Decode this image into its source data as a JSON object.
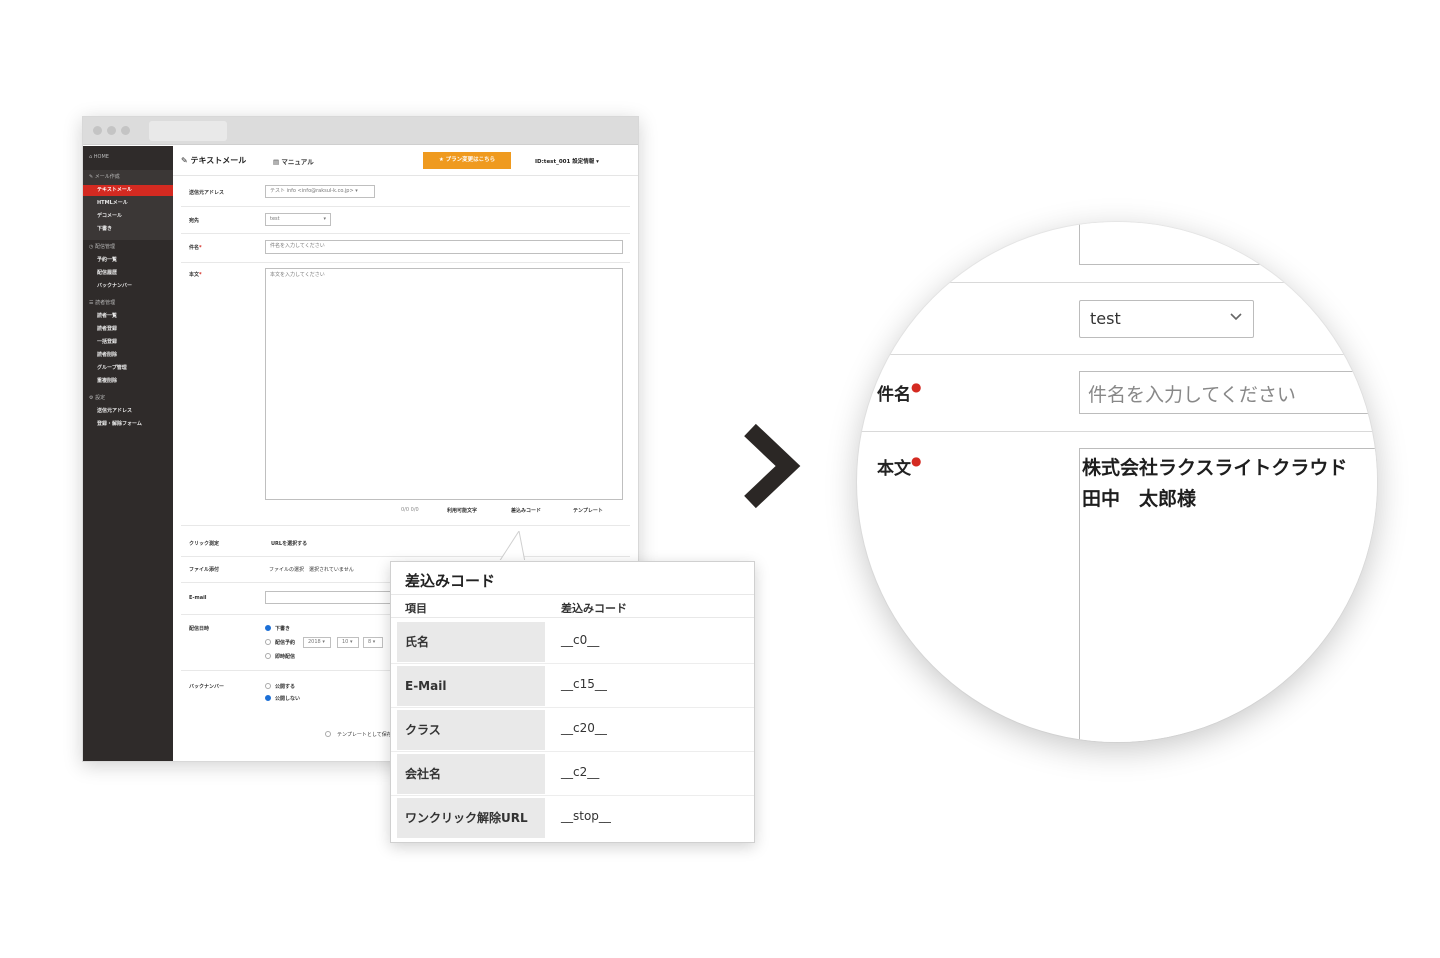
{
  "app": {
    "page_title": "テキストメール",
    "manual_label": "マニュアル",
    "upgrade_label": "プラン変更はこちら",
    "account_label": "ID:test_001 設定情報"
  },
  "sidebar": {
    "home": "HOME",
    "mail_group": "メール作成",
    "mail_items": [
      "テキストメール",
      "HTMLメール",
      "デコメール",
      "下書き"
    ],
    "delivery_group": "配信管理",
    "delivery_items": [
      "予約一覧",
      "配信履歴",
      "バックナンバー"
    ],
    "reader_group": "読者管理",
    "reader_items": [
      "読者一覧",
      "読者登録",
      "一括登録",
      "読者削除",
      "グループ管理",
      "重複削除"
    ],
    "settings_group": "設定",
    "settings_items": [
      "送信元アドレス",
      "登録・解除フォーム"
    ]
  },
  "form": {
    "sender_label": "送信元アドレス",
    "sender_value": "テスト info <info@raksul-k.co.jp>",
    "class_label": "宛先",
    "class_value": "test",
    "subject_label": "件名",
    "subject_placeholder": "件名を入力してください",
    "body_label": "本文",
    "body_placeholder": "本文を入力してください",
    "body_count": "0/0 0/0",
    "tool_labels": [
      "利用可能文字",
      "差込みコード",
      "テンプレート"
    ],
    "click_label": "クリック測定",
    "click_value": "URLを選択する",
    "file_label": "ファイル添付",
    "file_value": "ファイルの選択　選択されていません",
    "email_label": "E-mail",
    "schedule_label": "配信日時",
    "schedule_draft": "下書き",
    "schedule_reserve": "配信予約",
    "schedule_year": "2018",
    "schedule_month": "10",
    "schedule_day": "8",
    "schedule_now": "即時配信",
    "backnumber_label": "バックナンバー",
    "backnumber_yes": "公開する",
    "backnumber_no": "公開しない",
    "template_check": "テンプレートとして保存"
  },
  "popup": {
    "title": "差込みコード",
    "col_item": "項目",
    "col_code": "差込みコード",
    "rows": [
      {
        "item": "氏名",
        "code": "__c0__"
      },
      {
        "item": "E-Mail",
        "code": "__c15__"
      },
      {
        "item": "クラス",
        "code": "__c20__"
      },
      {
        "item": "会社名",
        "code": "__c2__"
      },
      {
        "item": "ワンクリック解除URL",
        "code": "__stop__"
      }
    ]
  },
  "magnified": {
    "class_value": "test",
    "subject_label": "件名",
    "subject_placeholder": "件名を入力してください",
    "body_label": "本文",
    "body_line1": "株式会社ラクスライトクラウド",
    "body_line2": "田中　太郎様"
  },
  "icons": {
    "arrow": "chevron-right-icon",
    "pencil": "pencil-icon",
    "book": "book-icon",
    "dropdown": "chevron-down-icon"
  },
  "colors": {
    "sidebar_bg": "#2f2b2a",
    "active_red": "#d42a21",
    "upgrade_orange": "#ef9a1f",
    "radio_blue": "#1c6fd6",
    "required_red": "#d42a21"
  }
}
